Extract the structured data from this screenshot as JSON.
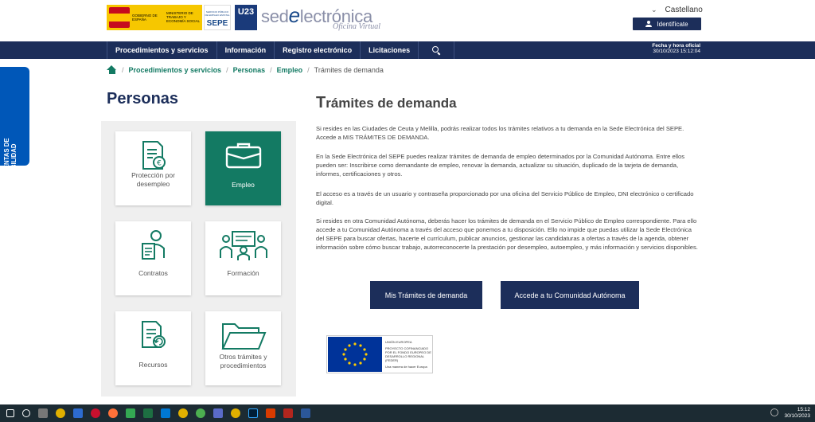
{
  "header": {
    "gov_logo_text_1": "GOBIERNO DE ESPAÑA",
    "gov_logo_text_2": "MINISTERIO DE TRABAJO Y ECONOMÍA SOCIAL",
    "sepe_small": "SERVICIO PÚBLICO DE EMPLEO ESTATAL",
    "sepe_label": "SEPE",
    "u23_label": "U23",
    "sede_prefix": "sed",
    "sede_e": "e",
    "sede_suffix": "lectrónica",
    "sede_subtitle": "Oficina Virtual",
    "language": "Castellano",
    "login_label": "Identifícate"
  },
  "nav": {
    "items": [
      "Procedimientos y servicios",
      "Información",
      "Registro electrónico",
      "Licitaciones"
    ],
    "datetime_label": "Fecha y hora oficial",
    "datetime_value": "30/10/2023   15:12:04"
  },
  "breadcrumb": {
    "items": [
      "Procedimientos y servicios",
      "Personas",
      "Empleo"
    ],
    "current": "Trámites de demanda"
  },
  "sidebar": {
    "title": "Personas",
    "cards": [
      {
        "label": "Protección por desempleo",
        "icon": "document-euro-icon"
      },
      {
        "label": "Empleo",
        "icon": "briefcase-icon"
      },
      {
        "label": "Contratos",
        "icon": "person-document-icon"
      },
      {
        "label": "Formación",
        "icon": "classroom-icon"
      },
      {
        "label": "Recursos",
        "icon": "document-refresh-icon"
      },
      {
        "label": "Otros trámites y procedimientos",
        "icon": "folder-icon"
      }
    ]
  },
  "main": {
    "title_cap": "T",
    "title_rest": "rámites de demanda",
    "paragraphs": [
      "Si resides en las Ciudades de Ceuta y Melilla, podrás realizar todos los trámites relativos a tu demanda en la Sede Electrónica del SEPE. Accede a MIS TRÁMITES DE DEMANDA.",
      "En la Sede Electrónica del SEPE puedes realizar trámites de demanda de empleo determinados por la Comunidad Autónoma. Entre ellos pueden ser: Inscribirse como demandante de empleo, renovar la demanda, actualizar su situación, duplicado de la tarjeta de demanda, informes, certificaciones y otros.",
      "El acceso es a través de un usuario y contraseña proporcionado por una oficina del Servicio Público de Empleo, DNI electrónico o certificado digital.",
      "Si resides en otra Comunidad Autónoma, deberás hacer los trámites de demanda en el Servicio Público de Empleo correspondiente. Para ello accede a tu Comunidad Autónoma a través del acceso que ponemos a tu disposición. Ello no impide que puedas utilizar la Sede Electrónica del SEPE para buscar ofertas, hacerte el currículum, publicar anuncios, gestionar las candidaturas a ofertas a través de la agenda, obtener información sobre cómo buscar trabajo, autorreconocerte la prestación por desempleo, autoempleo, y más información y servicios disponibles."
    ],
    "button_1": "Mis Trámites de demanda",
    "button_2": "Accede a tu Comunidad Autónoma",
    "eu_line_1": "UNIÓN EUROPEA",
    "eu_line_2": "PROYECTO COFINANCIADO POR EL FONDO EUROPEO DE DESARROLLO REGIONAL (FEDER)",
    "eu_line_3": "Una manera de hacer Europa"
  },
  "accessibility": {
    "label_1": "HERRAMIENTAS DE",
    "label_2": "ACCESIBILIDAD"
  },
  "taskbar": {
    "time": "15:12",
    "date": "30/10/2023"
  },
  "colors": {
    "navy": "#1c2e5a",
    "green": "#137a63",
    "accessibility_blue": "#0057b8"
  }
}
